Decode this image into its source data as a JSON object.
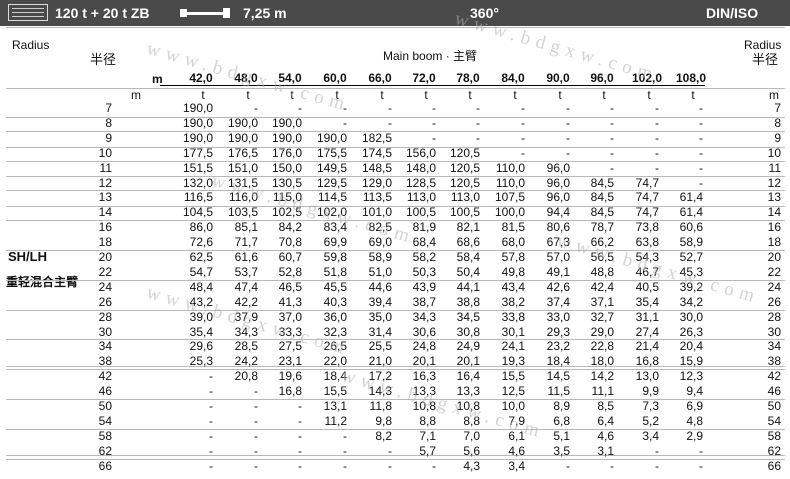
{
  "topbar": {
    "config": "120 t + 20 t ZB",
    "boom_length": "7,25 m",
    "slew": "360°",
    "standard": "DIN/ISO"
  },
  "header": {
    "radius_en_left": "Radius",
    "radius_cn_left": "半径",
    "radius_en_right": "Radius",
    "radius_cn_right": "半径",
    "main_boom": "Main boom · 主臂",
    "m_label": "m",
    "boom_lengths": [
      "42,0",
      "48,0",
      "54,0",
      "60,0",
      "66,0",
      "72,0",
      "78,0",
      "84,0",
      "90,0",
      "96,0",
      "102,0",
      "108,0"
    ],
    "unit_left": "m",
    "unit_right": "m",
    "unit_t": "t"
  },
  "side": {
    "mode": "SH/LH",
    "mode_cn": "重轻混合主臂"
  },
  "watermark": "www.bdgxw.com",
  "table": [
    {
      "r": "7",
      "v": [
        "190,0",
        "-",
        "-",
        "-",
        "-",
        "-",
        "-",
        "-",
        "-",
        "-",
        "-",
        "-"
      ]
    },
    {
      "r": "8",
      "v": [
        "190,0",
        "190,0",
        "190,0",
        "-",
        "-",
        "-",
        "-",
        "-",
        "-",
        "-",
        "-",
        "-"
      ]
    },
    {
      "r": "9",
      "v": [
        "190,0",
        "190,0",
        "190,0",
        "190,0",
        "182,5",
        "-",
        "-",
        "-",
        "-",
        "-",
        "-",
        "-"
      ]
    },
    {
      "r": "10",
      "v": [
        "177,5",
        "176,5",
        "176,0",
        "175,5",
        "174,5",
        "156,0",
        "120,5",
        "-",
        "-",
        "-",
        "-",
        "-"
      ]
    },
    {
      "r": "11",
      "v": [
        "151,5",
        "151,0",
        "150,0",
        "149,5",
        "148,5",
        "148,0",
        "120,5",
        "110,0",
        "96,0",
        "-",
        "-",
        "-"
      ]
    },
    {
      "r": "12",
      "v": [
        "132,0",
        "131,5",
        "130,5",
        "129,5",
        "129,0",
        "128,5",
        "120,5",
        "110,0",
        "96,0",
        "84,5",
        "74,7",
        "-"
      ]
    },
    {
      "r": "13",
      "v": [
        "116,5",
        "116,0",
        "115,0",
        "114,5",
        "113,5",
        "113,0",
        "113,0",
        "107,5",
        "96,0",
        "84,5",
        "74,7",
        "61,4"
      ]
    },
    {
      "r": "14",
      "v": [
        "104,5",
        "103,5",
        "102,5",
        "102,0",
        "101,0",
        "100,5",
        "100,5",
        "100,0",
        "94,4",
        "84,5",
        "74,7",
        "61,4"
      ]
    },
    {
      "r": "16",
      "v": [
        "86,0",
        "85,1",
        "84,2",
        "83,4",
        "82,5",
        "81,9",
        "82,1",
        "81,5",
        "80,6",
        "78,7",
        "73,8",
        "60,6"
      ]
    },
    {
      "r": "18",
      "v": [
        "72,6",
        "71,7",
        "70,8",
        "69,9",
        "69,0",
        "68,4",
        "68,6",
        "68,0",
        "67,3",
        "66,2",
        "63,8",
        "58,9"
      ]
    },
    {
      "r": "20",
      "v": [
        "62,5",
        "61,6",
        "60,7",
        "59,8",
        "58,9",
        "58,2",
        "58,4",
        "57,8",
        "57,0",
        "56,5",
        "54,3",
        "52,7"
      ]
    },
    {
      "r": "22",
      "v": [
        "54,7",
        "53,7",
        "52,8",
        "51,8",
        "51,0",
        "50,3",
        "50,4",
        "49,8",
        "49,1",
        "48,8",
        "46,7",
        "45,3"
      ]
    },
    {
      "r": "24",
      "v": [
        "48,4",
        "47,4",
        "46,5",
        "45,5",
        "44,6",
        "43,9",
        "44,1",
        "43,4",
        "42,6",
        "42,4",
        "40,5",
        "39,2"
      ]
    },
    {
      "r": "26",
      "v": [
        "43,2",
        "42,2",
        "41,3",
        "40,3",
        "39,4",
        "38,7",
        "38,8",
        "38,2",
        "37,4",
        "37,1",
        "35,4",
        "34,2"
      ]
    },
    {
      "r": "28",
      "v": [
        "39,0",
        "37,9",
        "37,0",
        "36,0",
        "35,0",
        "34,3",
        "34,5",
        "33,8",
        "33,0",
        "32,7",
        "31,1",
        "30,0"
      ]
    },
    {
      "r": "30",
      "v": [
        "35,4",
        "34,3",
        "33,3",
        "32,3",
        "31,4",
        "30,6",
        "30,8",
        "30,1",
        "29,3",
        "29,0",
        "27,4",
        "26,3"
      ]
    },
    {
      "r": "34",
      "v": [
        "29,6",
        "28,5",
        "27,5",
        "26,5",
        "25,5",
        "24,8",
        "24,9",
        "24,1",
        "23,2",
        "22,8",
        "21,4",
        "20,4"
      ]
    },
    {
      "r": "38",
      "v": [
        "25,3",
        "24,2",
        "23,1",
        "22,0",
        "21,0",
        "20,1",
        "20,1",
        "19,3",
        "18,4",
        "18,0",
        "16,8",
        "15,9"
      ]
    },
    {
      "r": "42",
      "v": [
        "-",
        "20,8",
        "19,6",
        "18,4",
        "17,2",
        "16,3",
        "16,4",
        "15,5",
        "14,5",
        "14,2",
        "13,0",
        "12,3"
      ]
    },
    {
      "r": "46",
      "v": [
        "-",
        "-",
        "16,8",
        "15,5",
        "14,3",
        "13,3",
        "13,3",
        "12,5",
        "11,5",
        "11,1",
        "9,9",
        "9,4"
      ]
    },
    {
      "r": "50",
      "v": [
        "-",
        "-",
        "-",
        "13,1",
        "11,8",
        "10,8",
        "10,8",
        "10,0",
        "8,9",
        "8,5",
        "7,3",
        "6,9"
      ]
    },
    {
      "r": "54",
      "v": [
        "-",
        "-",
        "-",
        "11,2",
        "9,8",
        "8,8",
        "8,8",
        "7,9",
        "6,8",
        "6,4",
        "5,2",
        "4,8"
      ]
    },
    {
      "r": "58",
      "v": [
        "-",
        "-",
        "-",
        "-",
        "8,2",
        "7,1",
        "7,0",
        "6,1",
        "5,1",
        "4,6",
        "3,4",
        "2,9"
      ]
    },
    {
      "r": "62",
      "v": [
        "-",
        "-",
        "-",
        "-",
        "-",
        "5,7",
        "5,6",
        "4,6",
        "3,5",
        "3,1",
        "-",
        "-"
      ]
    },
    {
      "r": "66",
      "v": [
        "-",
        "-",
        "-",
        "-",
        "-",
        "-",
        "4,3",
        "3,4",
        "-",
        "-",
        "-",
        "-"
      ]
    }
  ]
}
